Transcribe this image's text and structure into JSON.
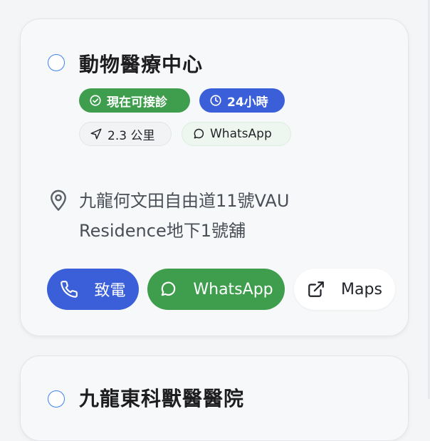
{
  "colors": {
    "accent_blue": "#3a5fd9",
    "accent_green": "#3f9e4d",
    "radio_border": "#3b82f6",
    "card_bg": "#f7f8f9"
  },
  "cards": [
    {
      "title": "動物醫療中心",
      "badges": {
        "open_now": {
          "label": "現在可接診",
          "icon": "check-circle-icon"
        },
        "hours": {
          "label": "24小時",
          "icon": "clock-icon"
        },
        "distance": {
          "label": "2.3 公里",
          "icon": "navigation-arrow-icon"
        },
        "whatsapp": {
          "label": "WhatsApp",
          "icon": "chat-bubble-icon"
        }
      },
      "address": {
        "icon": "map-pin-icon",
        "line1": "九龍何文田自由道11號VAU",
        "line2": "Residence地下1號舖"
      },
      "actions": {
        "call": {
          "label": "致電",
          "icon": "phone-icon"
        },
        "whatsapp": {
          "label": "WhatsApp",
          "icon": "chat-bubble-icon"
        },
        "maps": {
          "label": "Maps",
          "icon": "external-link-icon"
        }
      }
    },
    {
      "title": "九龍東科獸醫醫院"
    }
  ]
}
